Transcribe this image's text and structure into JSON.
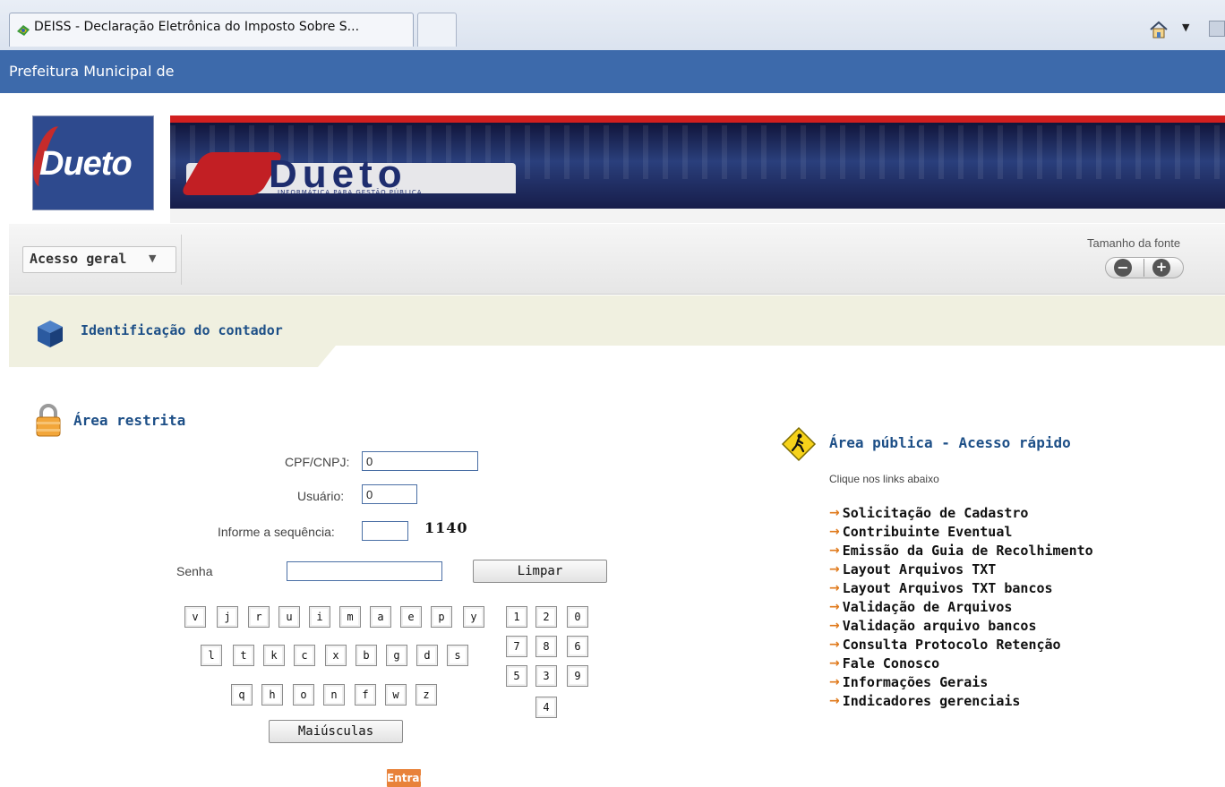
{
  "browser": {
    "tab_title": "DEISS - Declaração Eletrônica do Imposto Sobre S...",
    "home_icon": "home-icon",
    "rss_icon": "rss-icon"
  },
  "header": {
    "title": "Prefeitura Municipal de"
  },
  "banner": {
    "logo_text": "Dueto",
    "brand_word": "Dueto",
    "tagline": "INFORMÁTICA PARA GESTÃO PÚBLICA",
    "accent_red": "#d21f1f",
    "accent_blue": "#1e2d6e"
  },
  "toolbar": {
    "access_menu": "Acesso geral",
    "font_size_label": "Tamanho da fonte",
    "font_decrease": "−",
    "font_increase": "+"
  },
  "section": {
    "title": "Identificação do contador",
    "title_color": "#1d4f87",
    "background": "#f0f0e0"
  },
  "restricted": {
    "title": "Área restrita",
    "cpf_label": "CPF/CNPJ:",
    "cpf_value": "0",
    "usuario_label": "Usuário:",
    "usuario_value": "0",
    "sequence_label": "Informe a sequência:",
    "sequence_value": "",
    "sequence_code": "1140",
    "senha_label": "Senha",
    "senha_value": "",
    "clear_button": "Limpar",
    "caps_button": "Maiúsculas",
    "submit_button": "Entrar",
    "submit_color": "#e8823a"
  },
  "keyboard": {
    "row1": [
      "v",
      "j",
      "r",
      "u",
      "i",
      "m",
      "a",
      "e",
      "p",
      "y"
    ],
    "row2": [
      "l",
      "t",
      "k",
      "c",
      "x",
      "b",
      "g",
      "d",
      "s"
    ],
    "row3": [
      "q",
      "h",
      "o",
      "n",
      "f",
      "w",
      "z"
    ],
    "digits_row1": [
      "1",
      "2",
      "0"
    ],
    "digits_row2": [
      "7",
      "8",
      "6"
    ],
    "digits_row3": [
      "5",
      "3",
      "9"
    ],
    "digits_row4": [
      "4"
    ]
  },
  "public_area": {
    "title": "Área pública - Acesso rápido",
    "subtitle": "Clique nos links abaixo",
    "arrow_glyph": "→",
    "links": [
      "Solicitação de Cadastro",
      "Contribuinte Eventual",
      "Emissão da Guia de Recolhimento",
      "Layout Arquivos TXT",
      "Layout Arquivos TXT bancos",
      "Validação de Arquivos",
      "Validação arquivo bancos",
      "Consulta Protocolo Retenção",
      "Fale Conosco",
      "Informações Gerais",
      "Indicadores gerenciais"
    ]
  }
}
